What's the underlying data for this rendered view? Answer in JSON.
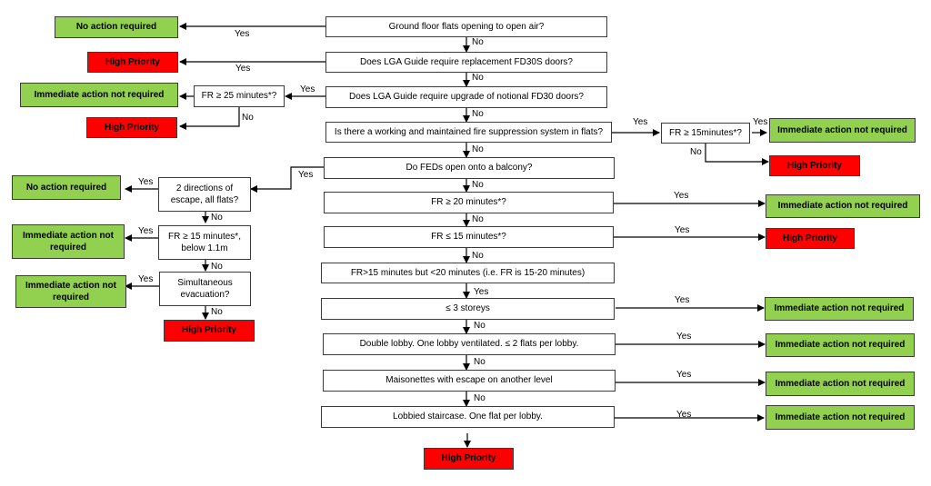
{
  "colors": {
    "positive": "#92d050",
    "negative": "#ff0000",
    "question": "#ffffff",
    "line": "#000000"
  },
  "main": {
    "q1": "Ground floor flats opening to open air?",
    "q2": "Does LGA Guide require replacement FD30S doors?",
    "q3": "Does LGA Guide require upgrade of notional FD30 doors?",
    "q4": "Is there a working and maintained fire suppression system in flats?",
    "q5": "Do FEDs open onto a balcony?",
    "q6": "FR ≥ 20 minutes*?",
    "q7": "FR ≤ 15 minutes*?",
    "q8": "FR>15 minutes but <20 minutes (i.e. FR is 15-20 minutes)",
    "q9": "≤ 3 storeys",
    "q10": "Double lobby. One lobby ventilated. ≤ 2 flats per lobby.",
    "q11": "Maisonettes with escape on another level",
    "q12": "Lobbied staircase. One flat per lobby."
  },
  "side": {
    "fr25": "FR ≥ 25 minutes*?",
    "fr15_right": "FR ≥ 15minutes*?",
    "two_dirs": "2 directions of escape, all flats?",
    "fr15_left": "FR ≥ 15 minutes*, below 1.1m",
    "simultaneous": "Simultaneous evacuation?"
  },
  "outcomes": {
    "no_action": "No action required",
    "high_priority": "High Priority",
    "immediate_not_required": "Immediate action not required",
    "immediate_not_required_wrapped": "Immediate action not required"
  },
  "labels": {
    "yes": "Yes",
    "no": "No"
  }
}
